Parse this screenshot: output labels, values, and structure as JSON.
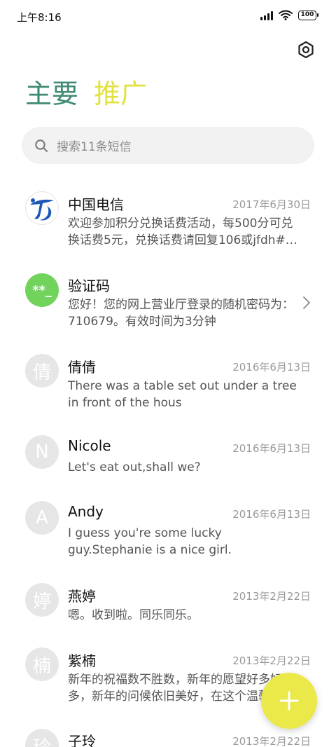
{
  "status_bar": {
    "time": "上午8:16",
    "battery": "100"
  },
  "tabs": [
    {
      "label": "主要",
      "active": true
    },
    {
      "label": "推广",
      "active": false
    }
  ],
  "search": {
    "placeholder": "搜索11条短信"
  },
  "messages": [
    {
      "sender": "中国电信",
      "date": "2017年6月30日",
      "preview": "欢迎参加积分兑换话费活动，每500分可兑\n换话费5元，兑换话费请回复106或jfdh#…",
      "avatar_type": "telecom-logo"
    },
    {
      "sender": "验证码",
      "date": "",
      "preview": "您好！您的网上营业厅登录的随机密码为：\n710679。有效时间为3分钟",
      "avatar": "**_",
      "avatar_type": "verify"
    },
    {
      "sender": "倩倩",
      "date": "2016年6月13日",
      "preview": "There was a table set out under a tree\nin front of the hous",
      "avatar": "倩"
    },
    {
      "sender": "Nicole",
      "date": "2016年6月13日",
      "preview": "Let's eat out,shall we?",
      "avatar": "N"
    },
    {
      "sender": "Andy",
      "date": "2016年6月13日",
      "preview": "I guess you're some lucky\nguy.Stephanie is a nice girl.",
      "avatar": "A"
    },
    {
      "sender": "燕婷",
      "date": "2013年2月22日",
      "preview": "嗯。收到啦。同乐同乐。",
      "avatar": "婷"
    },
    {
      "sender": "紫楠",
      "date": "2013年2月22日",
      "preview": "新年的祝福数不胜数，新年的愿望好多好\n多，新年的问候依旧美好，在这个温馨",
      "avatar": "楠"
    },
    {
      "sender": "子玲",
      "date": "2013年2月22日",
      "preview": "",
      "avatar": "玲"
    }
  ],
  "colors": {
    "accent_green": "#3e8a74",
    "accent_yellow": "#e1e142",
    "fab": "#ebe84a",
    "verify_avatar": "#72d35c",
    "telecom_blue": "#1b57b5"
  },
  "icons": {
    "settings": "hexagon-gear-icon",
    "search": "search-icon",
    "fab": "plus-icon",
    "chevron": "chevron-right-icon"
  }
}
